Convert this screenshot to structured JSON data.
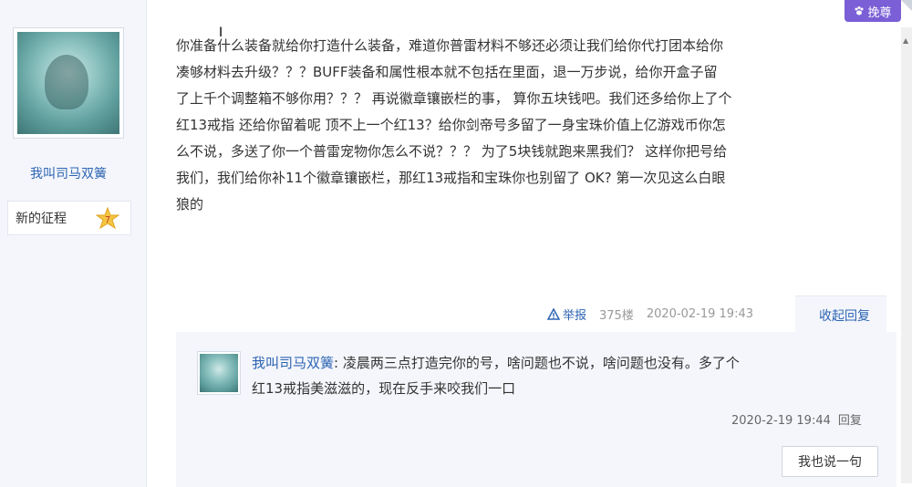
{
  "top_button": {
    "label": "挽尊"
  },
  "user": {
    "name": "我叫司马双簧",
    "badge_label": "新的征程",
    "badge_level": "7"
  },
  "post": {
    "lines": [
      "你准备什么装备就给你打造什么装备，难道你普雷材料不够还必须让我们给你代打团本给你",
      "凑够材料去升级？？？BUFF装备和属性根本就不包括在里面，退一万步说，给你开盒子留",
      "了上千个调整箱不够你用？？？ 再说徽章镶嵌栏的事， 算你五块钱吧。我们还多给你上了个",
      "红13戒指 还给你留着呢 顶不上一个红13？给你剑帝号多留了一身宝珠价值上亿游戏币你怎",
      "么不说，多送了你一个普雷宠物你怎么不说？？？ 为了5块钱就跑来黑我们？ 这样你把号给",
      "我们，我们给你补11个徽章镶嵌栏，那红13戒指和宝珠你也别留了 OK? 第一次见这么白眼",
      "狼的"
    ],
    "report_label": "举报",
    "floor": "375楼",
    "time": "2020-02-19 19:43",
    "collapse_label": "收起回复"
  },
  "reply": {
    "user": "我叫司马双簧",
    "separator": ": ",
    "text_line1": "凌晨两三点打造完你的号，啥问题也不说，啥问题也没有。多了个",
    "text_line2": "红13戒指美滋滋的，现在反手来咬我们一口",
    "time": "2020-2-19 19:44",
    "reply_link": "回复",
    "reply_button": "我也说一句"
  },
  "colors": {
    "link_blue": "#2d64b3",
    "badge_purple": "#7a5fd6",
    "panel_bg": "#f4f6fb"
  }
}
